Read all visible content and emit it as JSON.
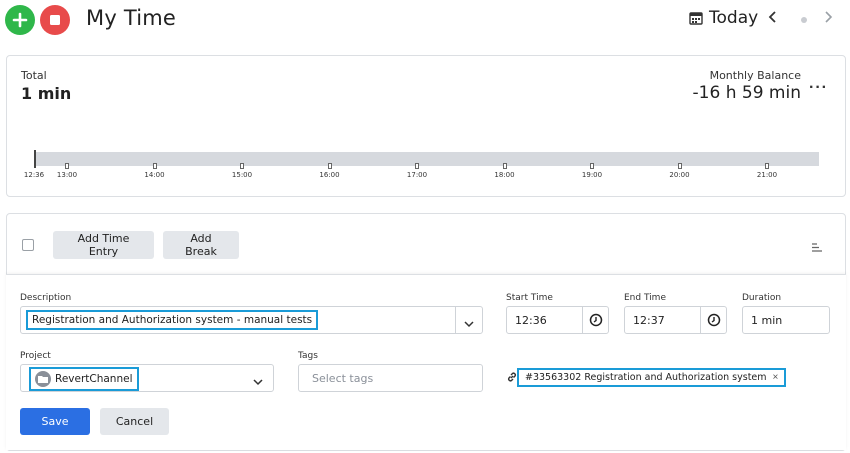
{
  "header": {
    "title": "My Time",
    "today_label": "Today",
    "icons": {
      "add": "plus-icon",
      "stop": "stop-icon",
      "calendar": "calendar-icon",
      "prev": "chevron-left-icon",
      "next": "chevron-right-icon"
    },
    "colors": {
      "add": "#2fb74a",
      "stop": "#e84b4b"
    }
  },
  "summary": {
    "total_label": "Total",
    "total_value": "1 min",
    "balance_label": "Monthly Balance",
    "balance_value": "-16 h 59 min",
    "more_label": "···",
    "timeline": {
      "start_label": "12:36",
      "ticks": [
        "13:00",
        "14:00",
        "15:00",
        "16:00",
        "17:00",
        "18:00",
        "19:00",
        "20:00",
        "21:00"
      ]
    }
  },
  "toolbar": {
    "add_entry_label": "Add Time Entry",
    "add_break_label": "Add Break"
  },
  "form": {
    "description_label": "Description",
    "description_value": "Registration and Authorization system - manual tests",
    "start_label": "Start Time",
    "start_value": "12:36",
    "end_label": "End Time",
    "end_value": "12:37",
    "duration_label": "Duration",
    "duration_value": "1 min",
    "project_label": "Project",
    "project_value": "RevertChannel",
    "tags_label": "Tags",
    "tags_placeholder": "Select tags",
    "ticket_value": "#33563302 Registration and Authorization system",
    "ticket_close": "×",
    "save_label": "Save",
    "cancel_label": "Cancel",
    "colors": {
      "save": "#2b6fe3",
      "highlight": "#1a9bd7"
    }
  }
}
